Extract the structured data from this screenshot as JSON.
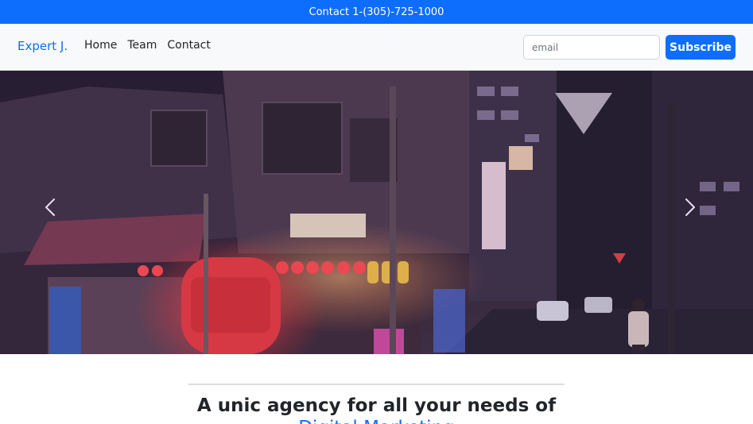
{
  "topbar": {
    "contact_text": "Contact 1-(305)-725-1000"
  },
  "navbar": {
    "brand": "Expert J.",
    "links": [
      {
        "label": "Home"
      },
      {
        "label": "Team"
      },
      {
        "label": "Contact"
      }
    ],
    "email_placeholder": "email",
    "email_value": "",
    "subscribe_label": "Subscribe"
  },
  "hero": {
    "prev_icon": "chevron-left-icon",
    "next_icon": "chevron-right-icon"
  },
  "main": {
    "headline": "A unic agency for all your needs of",
    "headline_accent": "Digital Marketing"
  },
  "colors": {
    "primary": "#0d6efd",
    "navbar_bg": "#f8f9fa",
    "text": "#212529"
  }
}
